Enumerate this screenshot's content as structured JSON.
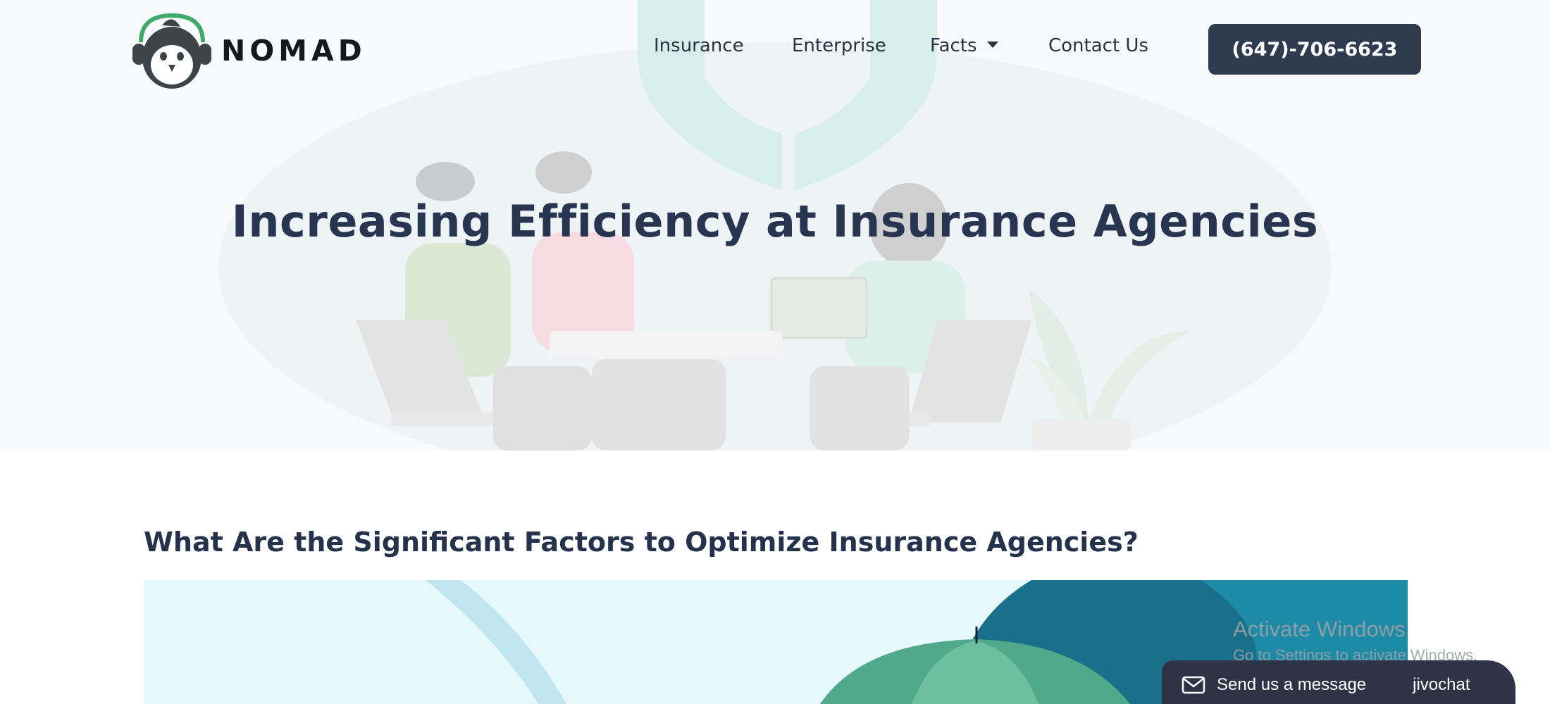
{
  "brand": {
    "name": "NOMAD",
    "logo_icon": "penguin-headset-icon"
  },
  "nav": {
    "items": [
      {
        "label": "Insurance"
      },
      {
        "label": "Enterprise"
      },
      {
        "label": "Facts",
        "icon": "caret-down-icon"
      },
      {
        "label": "Contact Us"
      }
    ],
    "phone_label": "(647)-706-6623"
  },
  "hero": {
    "title": "Increasing Efficiency at Insurance Agencies"
  },
  "content": {
    "heading": "What Are the Significant Factors to Optimize Insurance Agencies?"
  },
  "watermark": {
    "title": "Activate Windows",
    "subtitle": "Go to Settings to activate Windows."
  },
  "chat": {
    "label": "Send us a message",
    "brand": "jivochat",
    "icon": "envelope-icon"
  },
  "colors": {
    "primary_dark": "#2e3b4e",
    "heading": "#283550",
    "accent_green": "#3ea96a",
    "teal": "#1f7a8c"
  }
}
